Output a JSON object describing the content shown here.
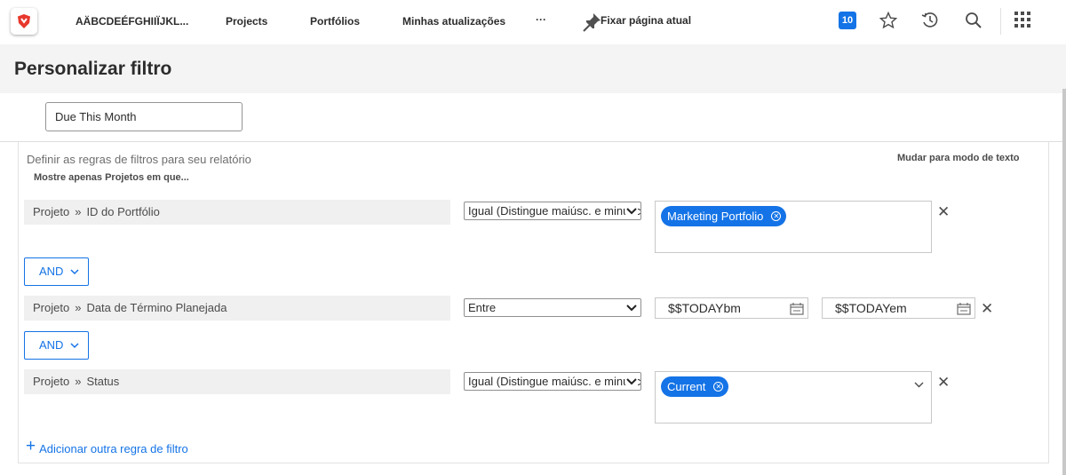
{
  "nav": {
    "company": "AÄBCDEÉFGHIIÏJKL...",
    "projects": "Projects",
    "portfolios": "Portfólios",
    "updates": "Minhas atualizações",
    "more": "···",
    "pin": "Fixar página atual",
    "badge": "10"
  },
  "page": {
    "title": "Personalizar filtro",
    "filter_name": "Due This Month",
    "description": "Definir as regras de filtros para seu relatório",
    "text_mode": "Mudar para modo de texto",
    "subtitle": "Mostre apenas Projetos em que..."
  },
  "rules": [
    {
      "object": "Projeto",
      "field": "ID do Portfólio",
      "operator": "Igual (Distingue maiúsc. e minúsc.)",
      "tag": "Marketing Portfolio"
    },
    {
      "object": "Projeto",
      "field": "Data de Término Planejada",
      "operator": "Entre",
      "value_from": "$$TODAYbm",
      "value_to": "$$TODAYem"
    },
    {
      "object": "Projeto",
      "field": "Status",
      "operator": "Igual (Distingue maiúsc. e minúsc.)",
      "tag": "Current"
    }
  ],
  "connectors": [
    "AND",
    "AND"
  ],
  "add_rule": "Adicionar outra regra de filtro",
  "colors": {
    "accent": "#1473e6",
    "header_bg": "#f4f4f4",
    "field_bg": "#f0f0f0"
  }
}
